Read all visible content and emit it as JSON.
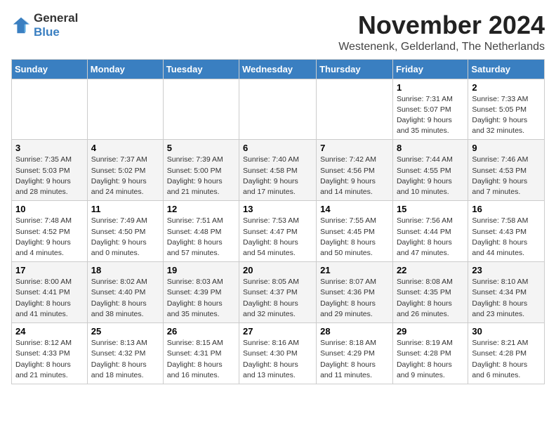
{
  "logo": {
    "text_general": "General",
    "text_blue": "Blue"
  },
  "title": "November 2024",
  "location": "Westenenk, Gelderland, The Netherlands",
  "days_of_week": [
    "Sunday",
    "Monday",
    "Tuesday",
    "Wednesday",
    "Thursday",
    "Friday",
    "Saturday"
  ],
  "weeks": [
    [
      {
        "day": "",
        "info": ""
      },
      {
        "day": "",
        "info": ""
      },
      {
        "day": "",
        "info": ""
      },
      {
        "day": "",
        "info": ""
      },
      {
        "day": "",
        "info": ""
      },
      {
        "day": "1",
        "info": "Sunrise: 7:31 AM\nSunset: 5:07 PM\nDaylight: 9 hours and 35 minutes."
      },
      {
        "day": "2",
        "info": "Sunrise: 7:33 AM\nSunset: 5:05 PM\nDaylight: 9 hours and 32 minutes."
      }
    ],
    [
      {
        "day": "3",
        "info": "Sunrise: 7:35 AM\nSunset: 5:03 PM\nDaylight: 9 hours and 28 minutes."
      },
      {
        "day": "4",
        "info": "Sunrise: 7:37 AM\nSunset: 5:02 PM\nDaylight: 9 hours and 24 minutes."
      },
      {
        "day": "5",
        "info": "Sunrise: 7:39 AM\nSunset: 5:00 PM\nDaylight: 9 hours and 21 minutes."
      },
      {
        "day": "6",
        "info": "Sunrise: 7:40 AM\nSunset: 4:58 PM\nDaylight: 9 hours and 17 minutes."
      },
      {
        "day": "7",
        "info": "Sunrise: 7:42 AM\nSunset: 4:56 PM\nDaylight: 9 hours and 14 minutes."
      },
      {
        "day": "8",
        "info": "Sunrise: 7:44 AM\nSunset: 4:55 PM\nDaylight: 9 hours and 10 minutes."
      },
      {
        "day": "9",
        "info": "Sunrise: 7:46 AM\nSunset: 4:53 PM\nDaylight: 9 hours and 7 minutes."
      }
    ],
    [
      {
        "day": "10",
        "info": "Sunrise: 7:48 AM\nSunset: 4:52 PM\nDaylight: 9 hours and 4 minutes."
      },
      {
        "day": "11",
        "info": "Sunrise: 7:49 AM\nSunset: 4:50 PM\nDaylight: 9 hours and 0 minutes."
      },
      {
        "day": "12",
        "info": "Sunrise: 7:51 AM\nSunset: 4:48 PM\nDaylight: 8 hours and 57 minutes."
      },
      {
        "day": "13",
        "info": "Sunrise: 7:53 AM\nSunset: 4:47 PM\nDaylight: 8 hours and 54 minutes."
      },
      {
        "day": "14",
        "info": "Sunrise: 7:55 AM\nSunset: 4:45 PM\nDaylight: 8 hours and 50 minutes."
      },
      {
        "day": "15",
        "info": "Sunrise: 7:56 AM\nSunset: 4:44 PM\nDaylight: 8 hours and 47 minutes."
      },
      {
        "day": "16",
        "info": "Sunrise: 7:58 AM\nSunset: 4:43 PM\nDaylight: 8 hours and 44 minutes."
      }
    ],
    [
      {
        "day": "17",
        "info": "Sunrise: 8:00 AM\nSunset: 4:41 PM\nDaylight: 8 hours and 41 minutes."
      },
      {
        "day": "18",
        "info": "Sunrise: 8:02 AM\nSunset: 4:40 PM\nDaylight: 8 hours and 38 minutes."
      },
      {
        "day": "19",
        "info": "Sunrise: 8:03 AM\nSunset: 4:39 PM\nDaylight: 8 hours and 35 minutes."
      },
      {
        "day": "20",
        "info": "Sunrise: 8:05 AM\nSunset: 4:37 PM\nDaylight: 8 hours and 32 minutes."
      },
      {
        "day": "21",
        "info": "Sunrise: 8:07 AM\nSunset: 4:36 PM\nDaylight: 8 hours and 29 minutes."
      },
      {
        "day": "22",
        "info": "Sunrise: 8:08 AM\nSunset: 4:35 PM\nDaylight: 8 hours and 26 minutes."
      },
      {
        "day": "23",
        "info": "Sunrise: 8:10 AM\nSunset: 4:34 PM\nDaylight: 8 hours and 23 minutes."
      }
    ],
    [
      {
        "day": "24",
        "info": "Sunrise: 8:12 AM\nSunset: 4:33 PM\nDaylight: 8 hours and 21 minutes."
      },
      {
        "day": "25",
        "info": "Sunrise: 8:13 AM\nSunset: 4:32 PM\nDaylight: 8 hours and 18 minutes."
      },
      {
        "day": "26",
        "info": "Sunrise: 8:15 AM\nSunset: 4:31 PM\nDaylight: 8 hours and 16 minutes."
      },
      {
        "day": "27",
        "info": "Sunrise: 8:16 AM\nSunset: 4:30 PM\nDaylight: 8 hours and 13 minutes."
      },
      {
        "day": "28",
        "info": "Sunrise: 8:18 AM\nSunset: 4:29 PM\nDaylight: 8 hours and 11 minutes."
      },
      {
        "day": "29",
        "info": "Sunrise: 8:19 AM\nSunset: 4:28 PM\nDaylight: 8 hours and 9 minutes."
      },
      {
        "day": "30",
        "info": "Sunrise: 8:21 AM\nSunset: 4:28 PM\nDaylight: 8 hours and 6 minutes."
      }
    ]
  ]
}
